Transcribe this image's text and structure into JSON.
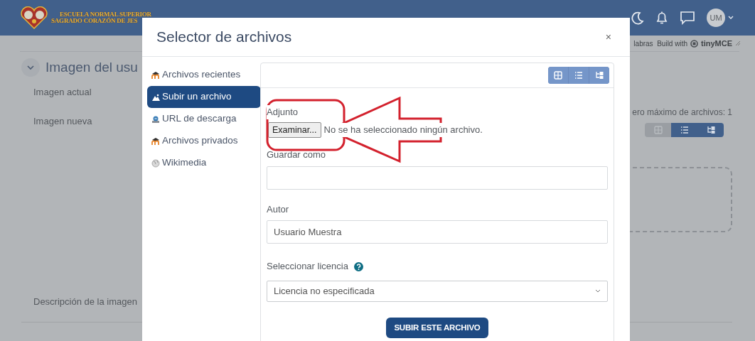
{
  "navbar": {
    "logo_lines": [
      "ESCUELA NORMAL SUPERIOR",
      "SAGRADO CORAZÓN DE JES"
    ],
    "avatar": "UM"
  },
  "editor_status": {
    "word_count": "labras",
    "brand_prefix": "Build with",
    "brand_name": "tinyMCE"
  },
  "page": {
    "section_title": "Imagen del usu",
    "expanded": true,
    "labels": [
      "Imagen actual",
      "Imagen nueva"
    ],
    "max_files": "ero máximo de archivos: 1",
    "view_buttons": [
      {
        "kind": "grid",
        "selected": true
      },
      {
        "kind": "list",
        "selected": false
      },
      {
        "kind": "tree",
        "selected": false
      }
    ],
    "description_label": "Descripción de la imagen"
  },
  "modal": {
    "title": "Selector de archivos",
    "close": "×",
    "repositories": [
      {
        "label": "Archivos recientes",
        "kind": "moodle",
        "selected": false
      },
      {
        "label": "Subir un archivo",
        "kind": "upload",
        "selected": true
      },
      {
        "label": "URL de descarga",
        "kind": "url",
        "selected": false
      },
      {
        "label": "Archivos privados",
        "kind": "moodle",
        "selected": false
      },
      {
        "label": "Wikimedia",
        "kind": "globe",
        "selected": false
      }
    ],
    "view_buttons": [
      {
        "kind": "grid"
      },
      {
        "kind": "list"
      },
      {
        "kind": "tree"
      }
    ],
    "attachment_label": "Adjunto",
    "browse_button": "Examinar...",
    "file_status": "No se ha seleccionado ningún archivo.",
    "save_as_label": "Guardar como",
    "author_label": "Autor",
    "author_value": "Usuario Muestra",
    "license_label": "Seleccionar licencia",
    "license_value": "Licencia no especificada",
    "submit": "SUBIR ESTE ARCHIVO"
  }
}
